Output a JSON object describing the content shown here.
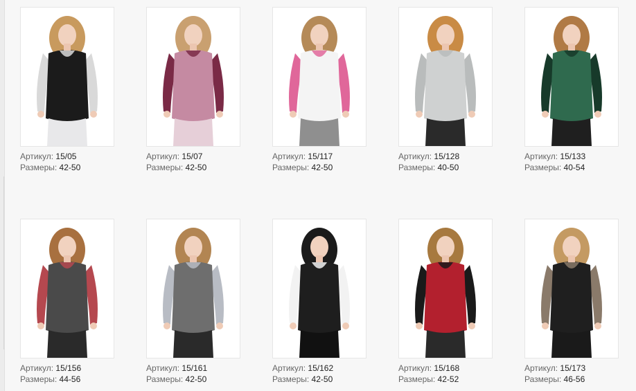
{
  "labels": {
    "article": "Артикул:",
    "sizes": "Размеры:"
  },
  "products": [
    {
      "article": "15/05",
      "sizes": "42-50",
      "colors": {
        "top": "#1b1b1b",
        "accent": "#d9d9d9",
        "bottom": "#e8e8ea"
      }
    },
    {
      "article": "15/07",
      "sizes": "42-50",
      "colors": {
        "top": "#c58aa2",
        "accent": "#7a2a46",
        "bottom": "#e6cfd8"
      }
    },
    {
      "article": "15/117",
      "sizes": "42-50",
      "colors": {
        "top": "#f4f4f4",
        "accent": "#e0679a",
        "bottom": "#8f8f8f"
      }
    },
    {
      "article": "15/128",
      "sizes": "40-50",
      "colors": {
        "top": "#cfd1d1",
        "accent": "#b9bcbc",
        "bottom": "#2a2a2a"
      }
    },
    {
      "article": "15/133",
      "sizes": "40-54",
      "colors": {
        "top": "#2f6a4e",
        "accent": "#173a2a",
        "bottom": "#1f1f1f"
      }
    },
    {
      "article": "15/156",
      "sizes": "44-56",
      "colors": {
        "top": "#4a4a4a",
        "accent": "#b5484f",
        "bottom": "#2a2a2a"
      }
    },
    {
      "article": "15/161",
      "sizes": "42-50",
      "colors": {
        "top": "#6e6e6e",
        "accent": "#b8bcc4",
        "bottom": "#2a2a2a"
      }
    },
    {
      "article": "15/162",
      "sizes": "42-50",
      "colors": {
        "top": "#1e1e1e",
        "accent": "#f2f2f2",
        "bottom": "#111111"
      }
    },
    {
      "article": "15/168",
      "sizes": "42-52",
      "colors": {
        "top": "#b3202e",
        "accent": "#1a1a1a",
        "bottom": "#2a2a2a"
      }
    },
    {
      "article": "15/173",
      "sizes": "46-56",
      "colors": {
        "top": "#1f1f1f",
        "accent": "#8a7a6a",
        "bottom": "#1a1a1a"
      }
    }
  ],
  "hair_colors": [
    "#c89a5e",
    "#c9a070",
    "#b58a58",
    "#c98b45",
    "#b07a45",
    "#a8703f",
    "#b28552",
    "#1b1b1b",
    "#a7793f",
    "#c49a62"
  ]
}
